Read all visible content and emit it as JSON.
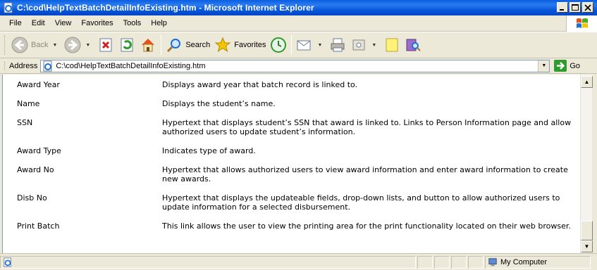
{
  "window": {
    "title": "C:\\cod\\HelpTextBatchDetailInfoExisting.htm - Microsoft Internet Explorer"
  },
  "menu": [
    "File",
    "Edit",
    "View",
    "Favorites",
    "Tools",
    "Help"
  ],
  "toolbar": {
    "back": "Back",
    "search": "Search",
    "favorites": "Favorites"
  },
  "address": {
    "label": "Address",
    "url": "C:\\cod\\HelpTextBatchDetailInfoExisting.htm",
    "go": "Go"
  },
  "rows": [
    {
      "term": "Award Year",
      "desc": "Displays award year that batch record is linked to."
    },
    {
      "term": "Name",
      "desc": "Displays the student’s name."
    },
    {
      "term": "SSN",
      "desc": "Hypertext that displays student’s SSN that award is linked to. Links to Person Information page and allow authorized users to update student’s information."
    },
    {
      "term": "Award Type",
      "desc": "Indicates type of award."
    },
    {
      "term": "Award No",
      "desc": "Hypertext that allows authorized users to view award information and enter award information to create new awards."
    },
    {
      "term": "Disb No",
      "desc": "Hypertext that displays the updateable fields, drop-down lists, and button to allow authorized users to update information for a selected disbursement."
    },
    {
      "term": "Print Batch",
      "desc": "This link allows the user to view the printing area for the print functionality located on their web browser."
    }
  ],
  "status": {
    "zone": "My Computer"
  },
  "colors": {
    "titlebar": "#0553d8",
    "chrome": "#ece9d8"
  }
}
